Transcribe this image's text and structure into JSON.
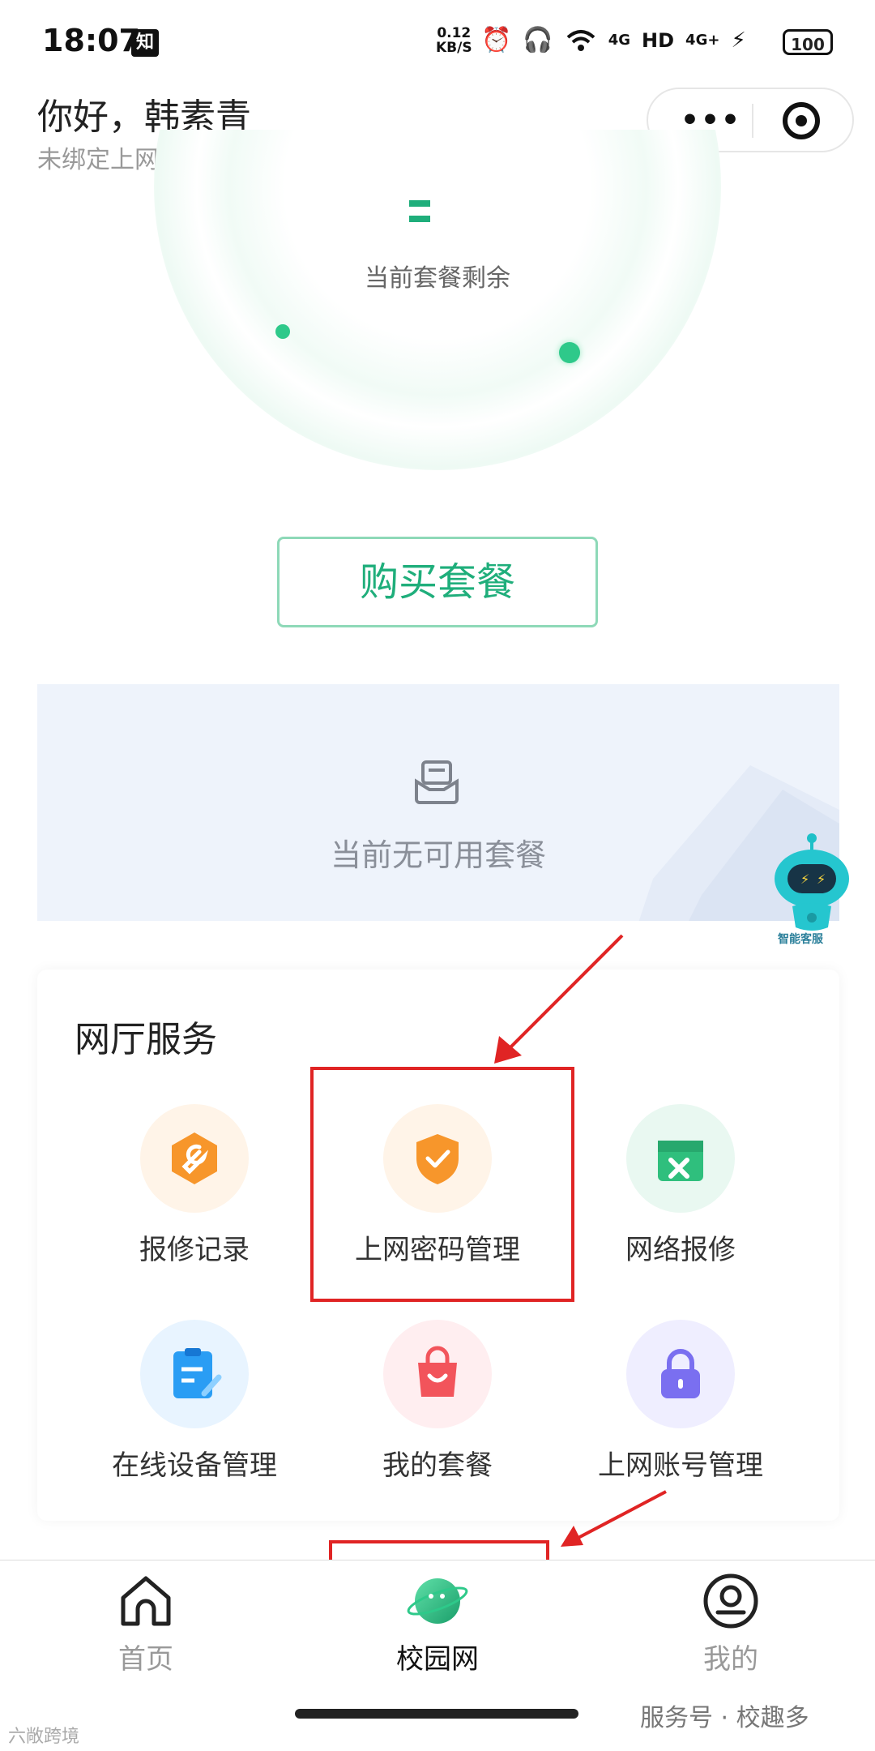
{
  "status_bar": {
    "time": "18:07",
    "zhihu_badge": "知",
    "net_speed_value": "0.12",
    "net_speed_unit": "KB/S",
    "icons": [
      "alarm-icon",
      "headphones-icon",
      "wifi-icon",
      "signal-4g-icon",
      "hd-icon",
      "signal-4g-plus-icon",
      "charging-icon"
    ],
    "signal_4g": "4G",
    "hd": "HD",
    "signal_4g_plus": "4G+",
    "battery": "100"
  },
  "header": {
    "greeting": "你好，韩素青",
    "account_status": "未绑定上网帐号",
    "more_label": "•••"
  },
  "package": {
    "remaining_label": "当前套餐剩余",
    "buy_button": "购买套餐",
    "empty_text": "当前无可用套餐",
    "support_label": "智能客服"
  },
  "services": {
    "title": "网厅服务",
    "items": [
      {
        "label": "报修记录",
        "icon": "wrench-icon",
        "color": "#f7962b"
      },
      {
        "label": "上网密码管理",
        "icon": "shield-check-icon",
        "color": "#f7962b"
      },
      {
        "label": "网络报修",
        "icon": "toolbox-icon",
        "color": "#2fbf7d"
      },
      {
        "label": "在线设备管理",
        "icon": "clipboard-icon",
        "color": "#2a9df4"
      },
      {
        "label": "我的套餐",
        "icon": "shopping-bag-icon",
        "color": "#f2545b"
      },
      {
        "label": "上网账号管理",
        "icon": "lock-icon",
        "color": "#7a6ff0"
      }
    ]
  },
  "nav": {
    "items": [
      {
        "label": "首页",
        "icon": "home-icon",
        "active": false
      },
      {
        "label": "校园网",
        "icon": "planet-icon",
        "active": true
      },
      {
        "label": "我的",
        "icon": "profile-icon",
        "active": false
      }
    ]
  },
  "watermark": {
    "text": "服务号 · 校趣多",
    "corner": "六敞跨境"
  },
  "colors": {
    "accent": "#1fae7b",
    "annotation": "#e02424"
  }
}
